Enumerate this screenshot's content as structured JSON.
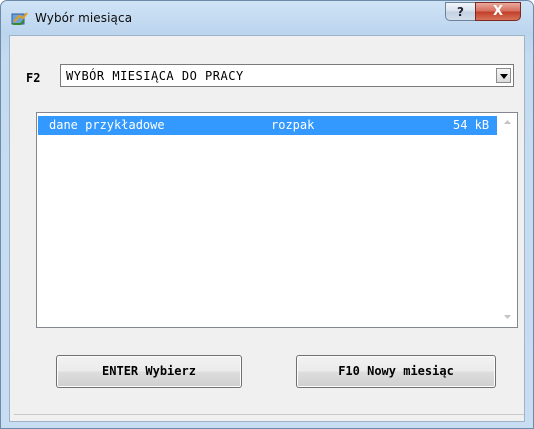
{
  "window": {
    "title": "Wybór miesiąca",
    "help_label": "?",
    "close_label": "X"
  },
  "selector": {
    "label": "F2",
    "value": "WYBÓR MIESIĄCA DO PRACY"
  },
  "list": {
    "rows": [
      {
        "name": "dane przykładowe",
        "status": "rozpak",
        "size": "54 kB",
        "selected": true
      }
    ]
  },
  "buttons": {
    "enter_label": "ENTER Wybierz",
    "new_label": "F10 Nowy miesiąc"
  },
  "colors": {
    "selection": "#3399ff",
    "close_button": "#c2402a"
  }
}
